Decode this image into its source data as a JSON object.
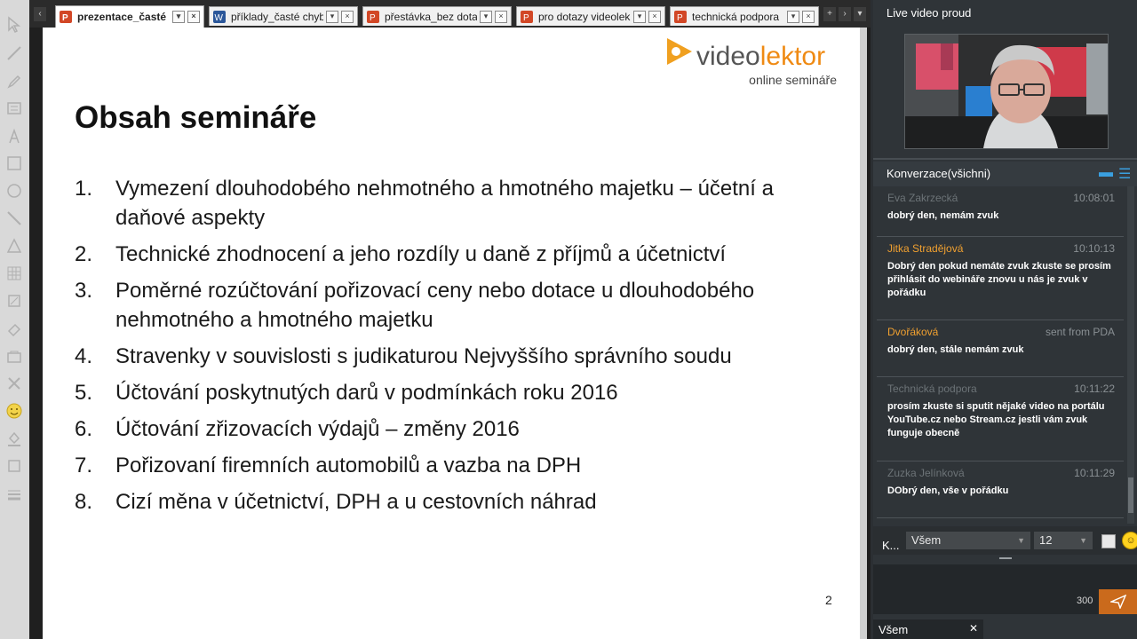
{
  "tabs": [
    {
      "label": "prezentace_časté",
      "type": "powerpoint",
      "active": true
    },
    {
      "label": "příklady_časté chyb",
      "type": "word",
      "active": false
    },
    {
      "label": "přestávka_bez dota",
      "type": "powerpoint",
      "active": false
    },
    {
      "label": "pro dotazy videolek",
      "type": "powerpoint",
      "active": false
    },
    {
      "label": "technická podpora",
      "type": "powerpoint",
      "active": false
    }
  ],
  "slide": {
    "logo_brand_a": "video",
    "logo_brand_b": "lektor",
    "logo_sub": "online semináře",
    "title": "Obsah semináře",
    "items": [
      {
        "num": "1.",
        "text": "Vymezení dlouhodobého nehmotného a hmotného majetku – účetní a daňové aspekty"
      },
      {
        "num": "2.",
        "text": "Technické zhodnocení a jeho rozdíly u daně z příjmů a účetnictví"
      },
      {
        "num": "3.",
        "text": "Poměrné rozúčtování pořizovací ceny nebo dotace u dlouhodobého nehmotného a hmotného majetku"
      },
      {
        "num": "4.",
        "text": "Stravenky v souvislosti s judikaturou Nejvyššího správního soudu"
      },
      {
        "num": "5.",
        "text": "Účtování poskytnutých darů v podmínkách roku 2016"
      },
      {
        "num": "6.",
        "text": "Účtování zřizovacích výdajů – změny 2016"
      },
      {
        "num": "7.",
        "text": "Pořizovaní firemních automobilů a vazba na DPH"
      },
      {
        "num": "8.",
        "text": "Cizí měna v účetnictví, DPH a u cestovních náhrad"
      }
    ],
    "page_number": "2"
  },
  "video": {
    "title": "Live video proud"
  },
  "chat": {
    "title": "Konverzace(všichni)",
    "messages": [
      {
        "author": "Eva Zakrzecká",
        "time": "10:08:01",
        "text": "dobrý den, nemám zvuk",
        "author_color": "#6c7377"
      },
      {
        "author": "Jitka Stradějová",
        "time": "10:10:13",
        "text": "Dobrý den pokud nemáte zvuk zkuste se prosím přihlásit do webináře znovu u nás je zvuk v pořádku",
        "author_color": "#f0a030"
      },
      {
        "author": "Dvořáková",
        "time": "sent from PDA",
        "text": "dobrý den, stále nemám zvuk",
        "author_color": "#f0a030"
      },
      {
        "author": "Technická podpora",
        "time": "10:11:22",
        "text": "prosím zkuste si sputit nějaké video na portálu YouTube.cz nebo Stream.cz jestli vám zvuk funguje obecně",
        "author_color": "#6c7377"
      },
      {
        "author": "Zuzka Jelínková",
        "time": "10:11:29",
        "text": "DObrý den, vše v pořádku",
        "author_color": "#6c7377"
      }
    ],
    "compose_label": "K...",
    "recipient": "Všem",
    "font_size": "12",
    "char_count": "300",
    "footer_tab": "Všem"
  }
}
